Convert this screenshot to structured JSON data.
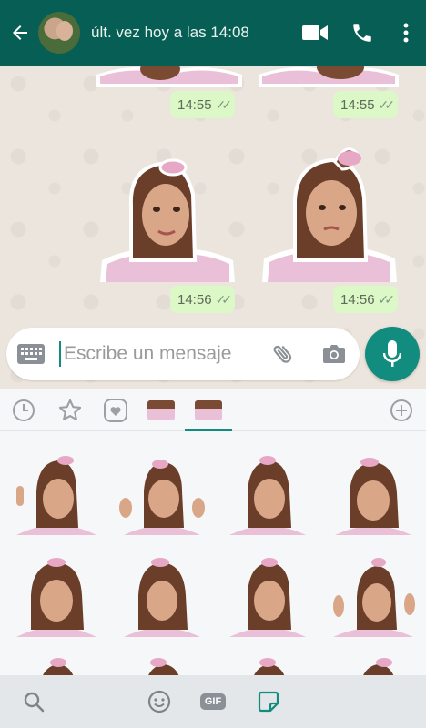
{
  "header": {
    "status": "últ. vez hoy a las 14:08"
  },
  "messages": [
    {
      "time": "14:55",
      "ticks": "✓✓"
    },
    {
      "time": "14:55",
      "ticks": "✓✓"
    },
    {
      "time": "14:56",
      "ticks": "✓✓"
    },
    {
      "time": "14:56",
      "ticks": "✓✓"
    }
  ],
  "input": {
    "placeholder": "Escribe un mensaje"
  },
  "bottom_bar": {
    "gif_label": "GIF"
  },
  "colors": {
    "header": "#075e54",
    "accent": "#128c7e",
    "bubble": "#dcf8c6",
    "sticker_outfit": "#e9c0d8",
    "sticker_hair": "#7a4a33"
  }
}
